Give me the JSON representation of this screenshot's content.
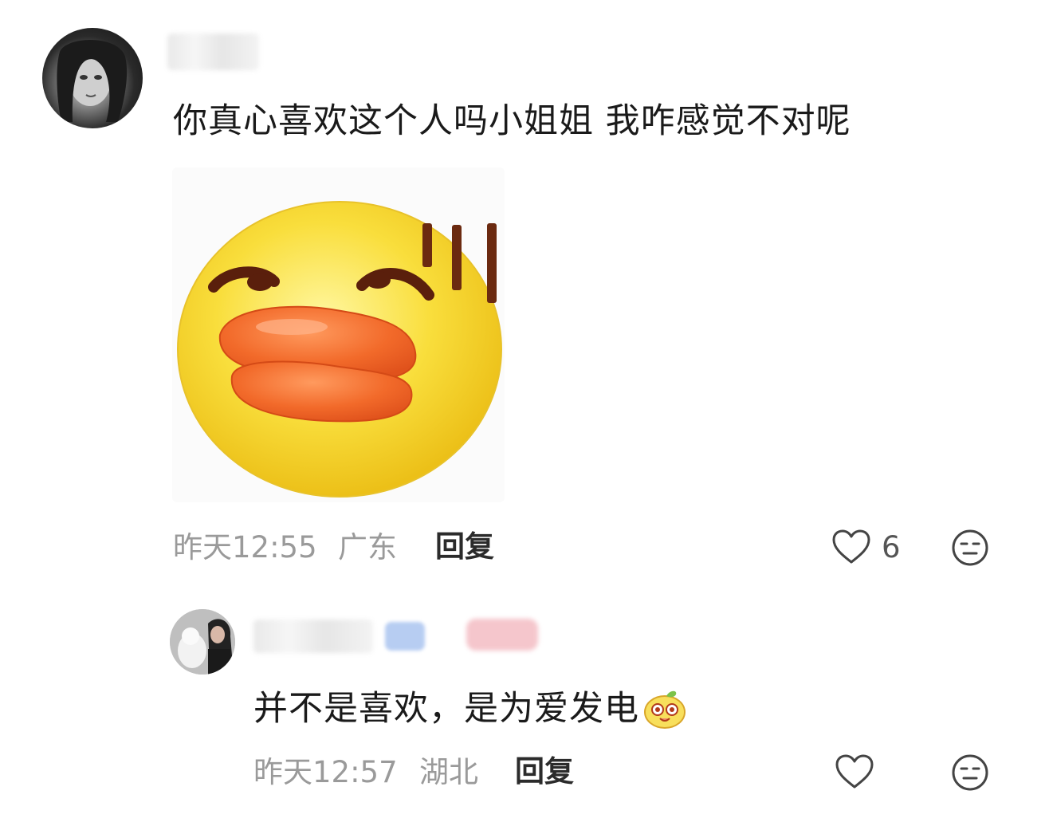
{
  "comments": [
    {
      "text": "你真心喜欢这个人吗小姐姐 我咋感觉不对呢",
      "sticker": "duck-face-sweat-sticker",
      "time": "昨天12:55",
      "location": "广东",
      "reply_label": "回复",
      "like_count": "6"
    },
    {
      "text": "并不是喜欢，是为爱发电",
      "emoji": "cute-face-emoji",
      "time": "昨天12:57",
      "location": "湖北",
      "reply_label": "回复"
    }
  ],
  "icons": {
    "like": "heart-outline-icon",
    "dislike": "neutral-face-icon"
  },
  "colors": {
    "meta_text": "#9a9a9a",
    "sticker_yellow": "#f6d72e",
    "sticker_orange": "#f0622a"
  }
}
